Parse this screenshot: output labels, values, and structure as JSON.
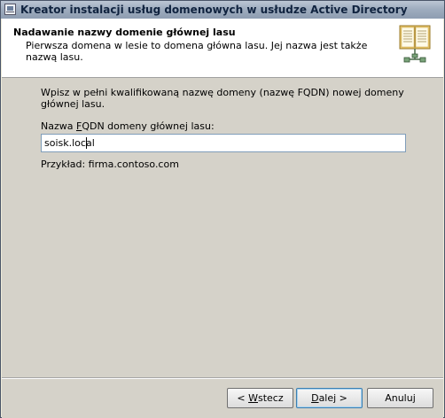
{
  "window": {
    "title": "Kreator instalacji usług domenowych w usłudze Active Directory"
  },
  "header": {
    "title": "Nadawanie nazwy domenie głównej lasu",
    "description": "Pierwsza domena w lesie to domena główna lasu. Jej nazwa jest także nazwą lasu.",
    "icon": "book-network-icon"
  },
  "main": {
    "instruction": "Wpisz w pełni kwalifikowaną nazwę domeny (nazwę FQDN) nowej domeny głównej lasu.",
    "field_label_pre": "Nazwa ",
    "field_label_mnemonic": "F",
    "field_label_post": "QDN domeny głównej lasu:",
    "fqdn_value": "soisk.local",
    "example": "Przykład: firma.contoso.com"
  },
  "footer": {
    "back_pre": "< ",
    "back_mnemonic": "W",
    "back_post": "stecz",
    "next_mnemonic": "D",
    "next_post": "alej >",
    "cancel_label": "Anuluj"
  }
}
